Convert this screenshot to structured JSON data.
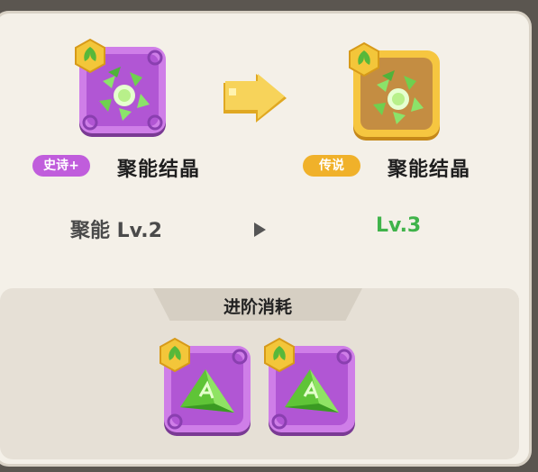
{
  "upgrade": {
    "from": {
      "rarity": "史诗+",
      "name": "聚能结晶",
      "level_text": "聚能 Lv.2"
    },
    "to": {
      "rarity": "传说",
      "name": "聚能结晶",
      "level_text": "Lv.3"
    }
  },
  "cost": {
    "title": "进阶消耗",
    "items": [
      {
        "icon": "green-prism-crystal"
      },
      {
        "icon": "green-prism-crystal"
      }
    ]
  },
  "colors": {
    "epic": "#c05ddc",
    "legendary": "#f0b12a",
    "level_up": "#3fb34a",
    "panel_bg": "#f4f0e8",
    "cost_bg": "#e6e0d6"
  }
}
